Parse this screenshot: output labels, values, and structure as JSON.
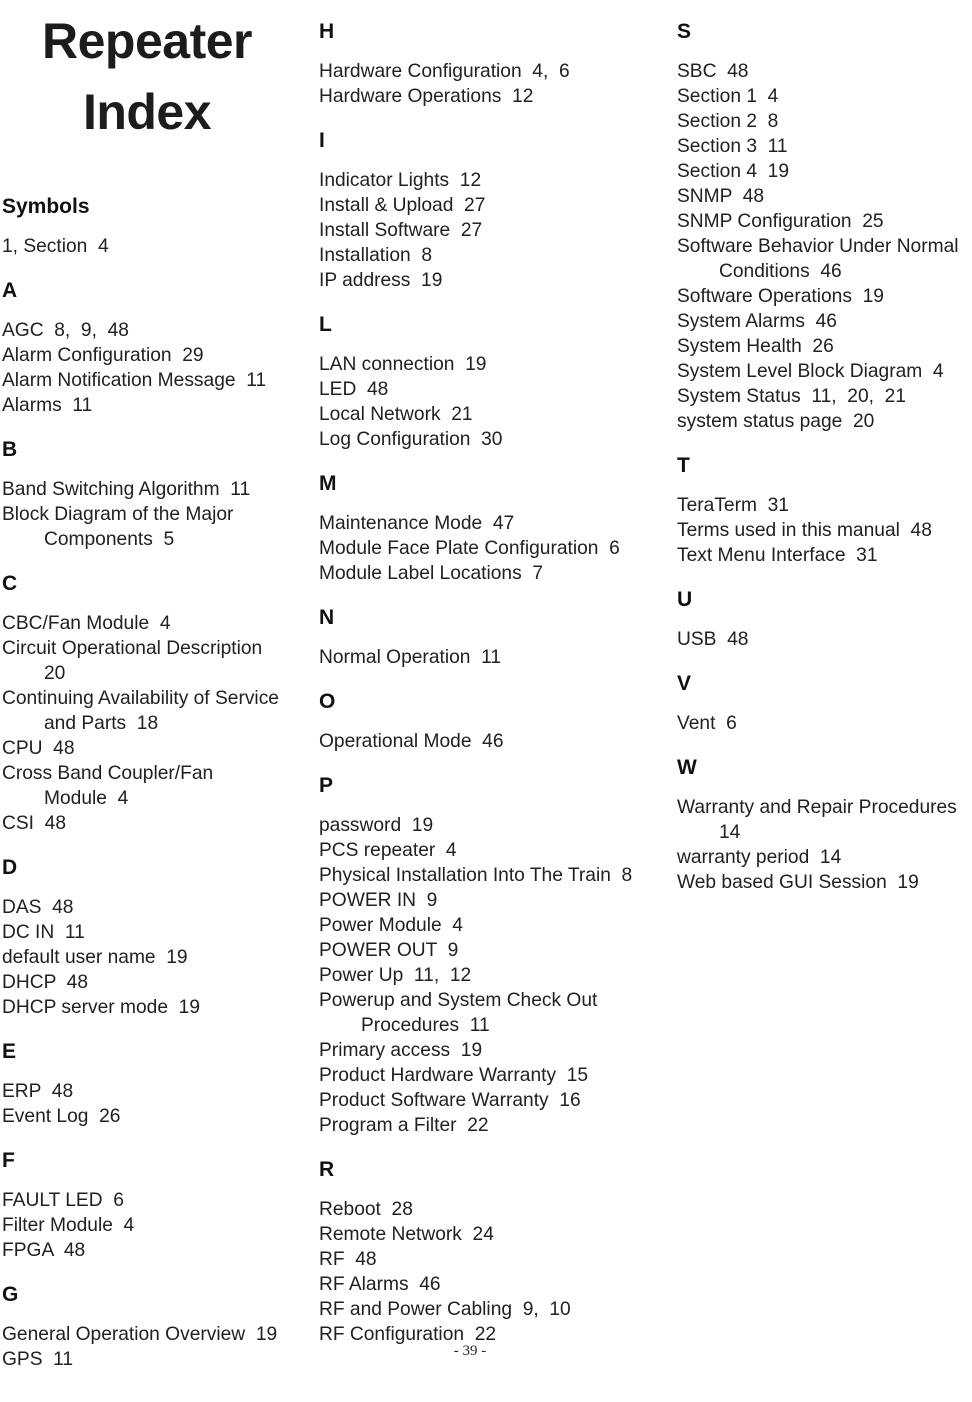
{
  "document": {
    "title_line_1": "Repeater",
    "title_line_2": "Index",
    "page_number": "- 39 -"
  },
  "columns": [
    {
      "id": "column-1",
      "sections": [
        {
          "letter": "Symbols",
          "letter_is_word": true,
          "entries": [
            {
              "text": "1, Section  4",
              "continuation": false
            }
          ]
        },
        {
          "letter": "A",
          "entries": [
            {
              "text": "AGC  8,  9,  48",
              "continuation": false
            },
            {
              "text": "Alarm Configuration  29",
              "continuation": false
            },
            {
              "text": "Alarm Notification Message  11",
              "continuation": false
            },
            {
              "text": "Alarms  11",
              "continuation": false
            }
          ]
        },
        {
          "letter": "B",
          "entries": [
            {
              "text": "Band Switching Algorithm  11",
              "continuation": false
            },
            {
              "text": "Block Diagram of the Major",
              "continuation": false
            },
            {
              "text": "Components  5",
              "continuation": true
            }
          ]
        },
        {
          "letter": "C",
          "entries": [
            {
              "text": "CBC/Fan Module  4",
              "continuation": false
            },
            {
              "text": "Circuit Operational Description",
              "continuation": false
            },
            {
              "text": "20",
              "continuation": true
            },
            {
              "text": "Continuing Availability of Service",
              "continuation": false
            },
            {
              "text": "and Parts  18",
              "continuation": true
            },
            {
              "text": "CPU  48",
              "continuation": false
            },
            {
              "text": "Cross Band Coupler/Fan",
              "continuation": false
            },
            {
              "text": "Module  4",
              "continuation": true
            },
            {
              "text": "CSI  48",
              "continuation": false
            }
          ]
        },
        {
          "letter": "D",
          "entries": [
            {
              "text": "DAS  48",
              "continuation": false
            },
            {
              "text": "DC IN  11",
              "continuation": false
            },
            {
              "text": "default user name  19",
              "continuation": false
            },
            {
              "text": "DHCP  48",
              "continuation": false
            },
            {
              "text": "DHCP server mode  19",
              "continuation": false
            }
          ]
        },
        {
          "letter": "E",
          "entries": [
            {
              "text": "ERP  48",
              "continuation": false
            },
            {
              "text": "Event Log  26",
              "continuation": false
            }
          ]
        },
        {
          "letter": "F",
          "entries": [
            {
              "text": "FAULT LED  6",
              "continuation": false
            },
            {
              "text": "Filter Module  4",
              "continuation": false
            },
            {
              "text": "FPGA  48",
              "continuation": false
            }
          ]
        },
        {
          "letter": "G",
          "entries": [
            {
              "text": "General Operation Overview  19",
              "continuation": false
            },
            {
              "text": "GPS  11",
              "continuation": false
            }
          ]
        }
      ]
    },
    {
      "id": "column-2",
      "sections": [
        {
          "letter": "H",
          "entries": [
            {
              "text": "Hardware Configuration  4,  6",
              "continuation": false
            },
            {
              "text": "Hardware Operations  12",
              "continuation": false
            }
          ]
        },
        {
          "letter": "I",
          "entries": [
            {
              "text": "Indicator Lights  12",
              "continuation": false
            },
            {
              "text": "Install & Upload  27",
              "continuation": false
            },
            {
              "text": "Install Software  27",
              "continuation": false
            },
            {
              "text": "Installation  8",
              "continuation": false
            },
            {
              "text": "IP address  19",
              "continuation": false
            }
          ]
        },
        {
          "letter": "L",
          "entries": [
            {
              "text": "LAN connection  19",
              "continuation": false
            },
            {
              "text": "LED  48",
              "continuation": false
            },
            {
              "text": "Local Network  21",
              "continuation": false
            },
            {
              "text": "Log Configuration  30",
              "continuation": false
            }
          ]
        },
        {
          "letter": "M",
          "entries": [
            {
              "text": "Maintenance Mode  47",
              "continuation": false
            },
            {
              "text": "Module Face Plate Configuration  6",
              "continuation": false
            },
            {
              "text": "Module Label Locations  7",
              "continuation": false
            }
          ]
        },
        {
          "letter": "N",
          "entries": [
            {
              "text": "Normal Operation  11",
              "continuation": false
            }
          ]
        },
        {
          "letter": "O",
          "entries": [
            {
              "text": "Operational Mode  46",
              "continuation": false
            }
          ]
        },
        {
          "letter": "P",
          "entries": [
            {
              "text": "password  19",
              "continuation": false
            },
            {
              "text": "PCS repeater  4",
              "continuation": false
            },
            {
              "text": "Physical Installation Into The Train  8",
              "continuation": false
            },
            {
              "text": "POWER IN  9",
              "continuation": false
            },
            {
              "text": "Power Module  4",
              "continuation": false
            },
            {
              "text": "POWER OUT  9",
              "continuation": false
            },
            {
              "text": "Power Up  11,  12",
              "continuation": false
            },
            {
              "text": "Powerup and System Check Out",
              "continuation": false
            },
            {
              "text": "Procedures  11",
              "continuation": true
            },
            {
              "text": "Primary access  19",
              "continuation": false
            },
            {
              "text": "Product Hardware Warranty  15",
              "continuation": false
            },
            {
              "text": "Product Software Warranty  16",
              "continuation": false
            },
            {
              "text": "Program a Filter  22",
              "continuation": false
            }
          ]
        },
        {
          "letter": "R",
          "entries": [
            {
              "text": "Reboot  28",
              "continuation": false
            },
            {
              "text": "Remote Network  24",
              "continuation": false
            },
            {
              "text": "RF  48",
              "continuation": false
            },
            {
              "text": "RF Alarms  46",
              "continuation": false
            },
            {
              "text": "RF and Power Cabling  9,  10",
              "continuation": false
            },
            {
              "text": "RF Configuration  22",
              "continuation": false
            }
          ]
        }
      ]
    },
    {
      "id": "column-3",
      "sections": [
        {
          "letter": "S",
          "entries": [
            {
              "text": "SBC  48",
              "continuation": false
            },
            {
              "text": "Section 1  4",
              "continuation": false
            },
            {
              "text": "Section 2  8",
              "continuation": false
            },
            {
              "text": "Section 3  11",
              "continuation": false
            },
            {
              "text": "Section 4  19",
              "continuation": false
            },
            {
              "text": "SNMP  48",
              "continuation": false
            },
            {
              "text": "SNMP Configuration  25",
              "continuation": false
            },
            {
              "text": "Software Behavior Under Normal",
              "continuation": false
            },
            {
              "text": "Conditions  46",
              "continuation": true
            },
            {
              "text": "Software Operations  19",
              "continuation": false
            },
            {
              "text": "System Alarms  46",
              "continuation": false
            },
            {
              "text": "System Health  26",
              "continuation": false
            },
            {
              "text": "System Level Block Diagram  4",
              "continuation": false
            },
            {
              "text": "System Status  11,  20,  21",
              "continuation": false
            },
            {
              "text": "system status page  20",
              "continuation": false
            }
          ]
        },
        {
          "letter": "T",
          "entries": [
            {
              "text": "TeraTerm  31",
              "continuation": false
            },
            {
              "text": "Terms used in this manual  48",
              "continuation": false
            },
            {
              "text": "Text Menu Interface  31",
              "continuation": false
            }
          ]
        },
        {
          "letter": "U",
          "entries": [
            {
              "text": "USB  48",
              "continuation": false
            }
          ]
        },
        {
          "letter": "V",
          "entries": [
            {
              "text": "Vent  6",
              "continuation": false
            }
          ]
        },
        {
          "letter": "W",
          "entries": [
            {
              "text": "Warranty and Repair Procedures",
              "continuation": false
            },
            {
              "text": "14",
              "continuation": true
            },
            {
              "text": "warranty period  14",
              "continuation": false
            },
            {
              "text": "Web based GUI Session  19",
              "continuation": false
            }
          ]
        }
      ]
    }
  ]
}
